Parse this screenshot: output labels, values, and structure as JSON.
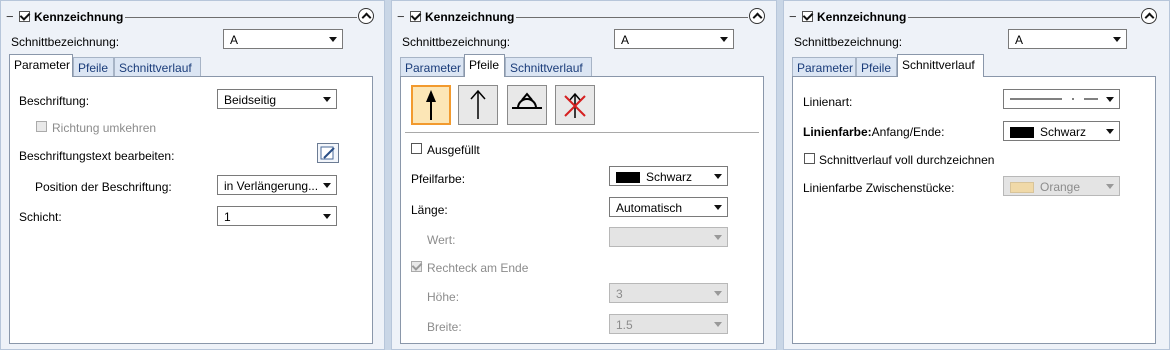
{
  "panels": [
    {
      "header": {
        "title": "Kennzeichnung",
        "checked": true
      },
      "section_label": "Schnittbezeichnung:",
      "section_value": "A",
      "tabs": [
        {
          "label": "Parameter"
        },
        {
          "label": "Pfeile"
        },
        {
          "label": "Schnittverlauf"
        }
      ],
      "active_tab": "Parameter",
      "fields": {
        "beschriftung_label": "Beschriftung:",
        "beschriftung_value": "Beidseitig",
        "richtung_label": "Richtung umkehren",
        "bearbeiten_label": "Beschriftungstext bearbeiten:",
        "position_label": "Position der Beschriftung:",
        "position_value": "in Verlängerung...",
        "schicht_label": "Schicht:",
        "schicht_value": "1"
      }
    },
    {
      "header": {
        "title": "Kennzeichnung",
        "checked": true
      },
      "section_label": "Schnittbezeichnung:",
      "section_value": "A",
      "tabs": [
        {
          "label": "Parameter"
        },
        {
          "label": "Pfeile"
        },
        {
          "label": "Schnittverlauf"
        }
      ],
      "active_tab": "Pfeile",
      "arrow_tools": [
        {
          "icon": "arrow-filled-icon",
          "selected": true
        },
        {
          "icon": "arrow-open-icon",
          "selected": false
        },
        {
          "icon": "arrow-dome-icon",
          "selected": false
        },
        {
          "icon": "arrow-none-icon",
          "selected": false
        }
      ],
      "fields": {
        "ausgefuellt_label": "Ausgefüllt",
        "pfeilfarbe_label": "Pfeilfarbe:",
        "pfeilfarbe_value": "Schwarz",
        "pfeilfarbe_color": "#000000",
        "laenge_label": "Länge:",
        "laenge_value": "Automatisch",
        "wert_label": "Wert:",
        "wert_value": "",
        "rechteck_label": "Rechteck am Ende",
        "hoehe_label": "Höhe:",
        "hoehe_value": "3",
        "breite_label": "Breite:",
        "breite_value": "1.5"
      }
    },
    {
      "header": {
        "title": "Kennzeichnung",
        "checked": true
      },
      "section_label": "Schnittbezeichnung:",
      "section_value": "A",
      "tabs": [
        {
          "label": "Parameter"
        },
        {
          "label": "Pfeile"
        },
        {
          "label": "Schnittverlauf"
        }
      ],
      "active_tab": "Schnittverlauf",
      "fields": {
        "linienart_label": "Linienart:",
        "linienfarbe_label_bold": "Linienfarbe:",
        "linienfarbe_label_rest": "Anfang/Ende:",
        "linienfarbe_value": "Schwarz",
        "linienfarbe_color": "#000000",
        "voll_label": "Schnittverlauf voll durchzeichnen",
        "zwischen_label": "Linienfarbe Zwischenstücke:",
        "zwischen_value": "Orange",
        "zwischen_color": "#f0d9a8"
      }
    }
  ]
}
